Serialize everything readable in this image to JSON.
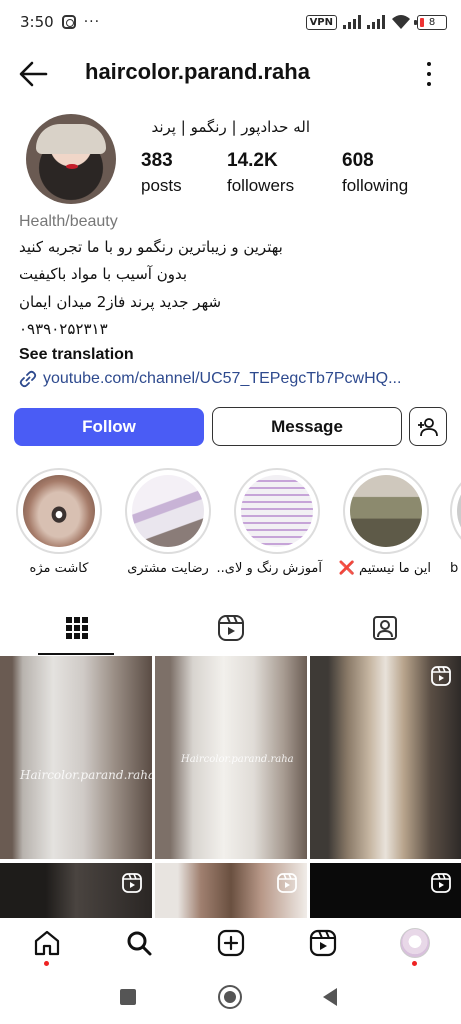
{
  "status_bar": {
    "time": "3:50",
    "dots": "···",
    "vpn": "VPN",
    "battery": "8"
  },
  "header": {
    "username": "haircolor.parand.raha"
  },
  "profile": {
    "full_name": "اله حدادپور | رنگمو | پرند",
    "stats": [
      {
        "value": "383",
        "label": "posts"
      },
      {
        "value": "14.2K",
        "label": "followers"
      },
      {
        "value": "608",
        "label": "following"
      }
    ],
    "category": "Health/beauty",
    "bio": [
      "بهترین و زیباترین رنگمو رو با ما تجربه کنید",
      "بدون آسیب با مواد باکیفیت",
      "شهر جدید پرند فاز2 میدان ایمان",
      "۰۹۳۹۰۲۵۲۳۱۳"
    ],
    "see_translation": "See translation",
    "link": "youtube.com/channel/UC57_TEPegcTb7PcwHQ..."
  },
  "actions": {
    "follow": "Follow",
    "message": "Message"
  },
  "highlights": [
    {
      "label": "کاشت مژه"
    },
    {
      "label": "رضایت مشتری"
    },
    {
      "label": "آموزش رنگ و لای.."
    },
    {
      "label": "این ما نیستیم ❌"
    },
    {
      "label": "b"
    }
  ],
  "grid_watermarks": [
    "Haircolor.parand.raha",
    "Haircolor.parand.raha"
  ],
  "colors": {
    "follow_blue": "#4a5cf5",
    "link_blue": "#2e4a8e",
    "notif_red": "#e22"
  }
}
